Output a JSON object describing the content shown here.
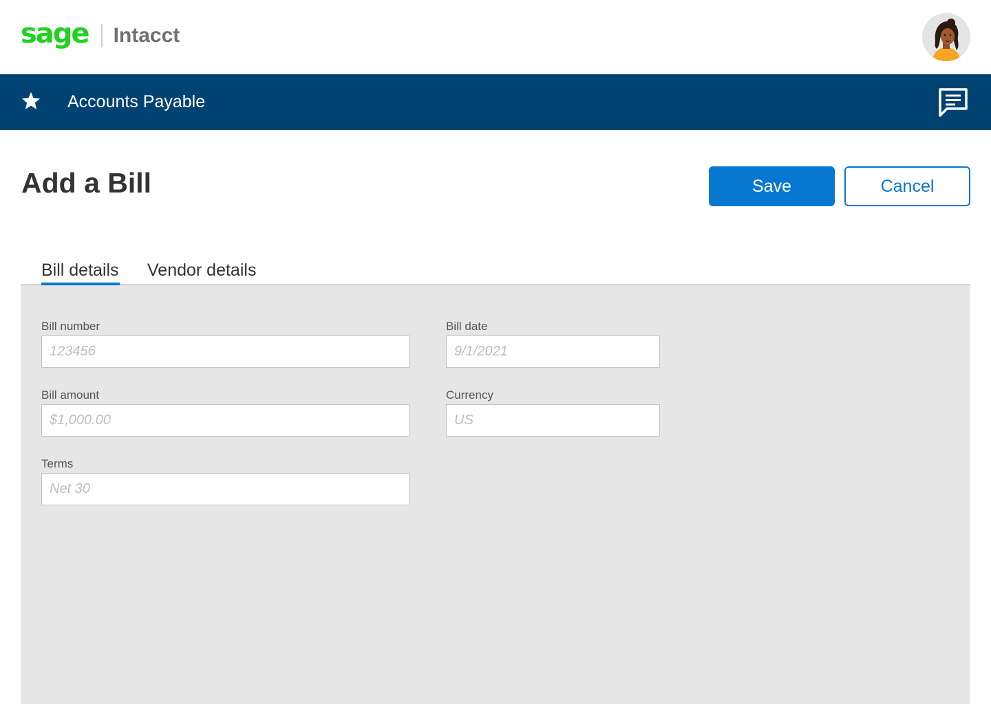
{
  "header": {
    "brand_primary": "sage",
    "brand_product": "Intacct",
    "avatar_icon": "user-avatar-icon"
  },
  "nav": {
    "title": "Accounts Payable",
    "favorite_icon": "star-icon",
    "chat_icon": "chat-icon",
    "background_color": "#004372"
  },
  "page": {
    "title": "Add a Bill",
    "save_label": "Save",
    "cancel_label": "Cancel",
    "accent_color": "#0777d0"
  },
  "tabs": [
    {
      "label": "Bill details",
      "active": true
    },
    {
      "label": "Vendor details",
      "active": false
    }
  ],
  "form": {
    "bill_number": {
      "label": "Bill number",
      "placeholder": "123456",
      "value": ""
    },
    "bill_date": {
      "label": "Bill date",
      "placeholder": "9/1/2021",
      "value": ""
    },
    "bill_amount": {
      "label": "Bill amount",
      "placeholder": "$1,000.00",
      "value": ""
    },
    "currency": {
      "label": "Currency",
      "placeholder": "US",
      "value": ""
    },
    "terms": {
      "label": "Terms",
      "placeholder": "Net 30",
      "value": ""
    }
  }
}
